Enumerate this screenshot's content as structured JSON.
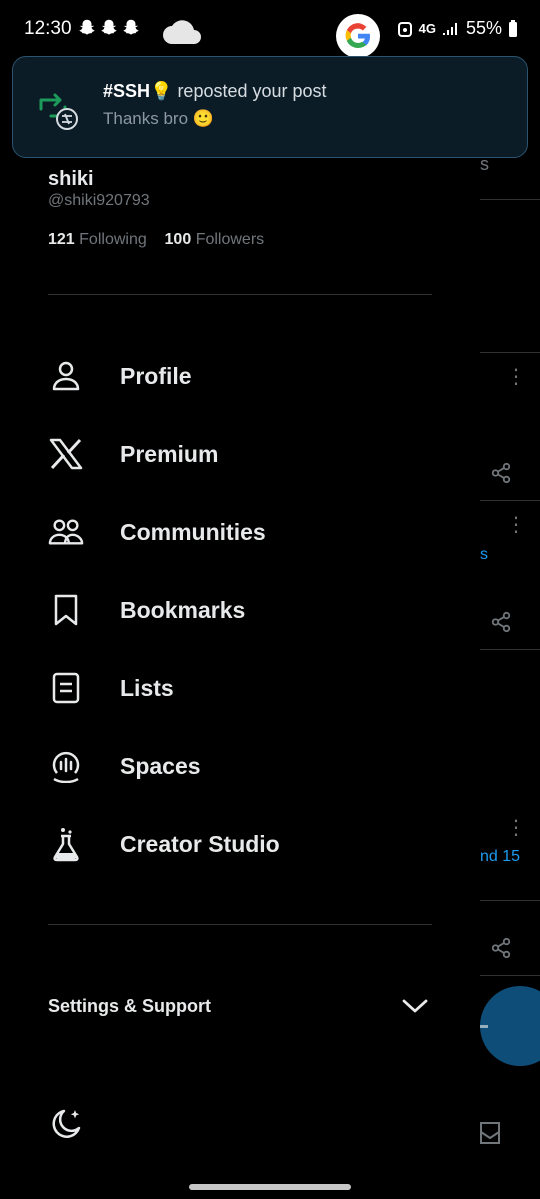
{
  "status_bar": {
    "time": "12:30",
    "network": "4G",
    "battery": "55%",
    "icons": [
      "snapchat-icon",
      "snapchat-icon",
      "snapchat-icon",
      "cloud-icon",
      "google-icon",
      "signal-icon",
      "battery-icon"
    ]
  },
  "notification": {
    "sender": "#SSH💡",
    "action": " reposted your post",
    "message": "Thanks bro 🙂",
    "icon": "repost-icon",
    "accent_color": "#1d9b5a"
  },
  "profile": {
    "name": "shiki",
    "handle": "@shiki920793",
    "following_count": "121",
    "following_label": "Following",
    "followers_count": "100",
    "followers_label": "Followers"
  },
  "menu": {
    "items": [
      {
        "label": "Profile",
        "icon": "person-icon"
      },
      {
        "label": "Premium",
        "icon": "x-logo-icon"
      },
      {
        "label": "Communities",
        "icon": "communities-icon"
      },
      {
        "label": "Bookmarks",
        "icon": "bookmark-icon"
      },
      {
        "label": "Lists",
        "icon": "list-icon"
      },
      {
        "label": "Spaces",
        "icon": "spaces-icon"
      },
      {
        "label": "Creator Studio",
        "icon": "flask-icon"
      }
    ]
  },
  "settings": {
    "label": "Settings & Support",
    "icon": "chevron-down-icon"
  },
  "footer": {
    "theme_icon": "moon-icon"
  },
  "background": {
    "peek_text_1": "s",
    "peek_text_2": "s",
    "peek_text_3": "nd 15",
    "accent": "#1d9bf0"
  }
}
